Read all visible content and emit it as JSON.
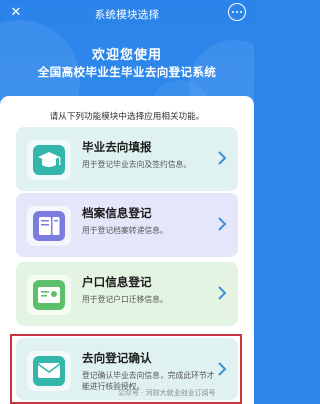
{
  "nav": {
    "title": "系统模块选择",
    "close_icon": "close-icon",
    "more_icon": "more-icon"
  },
  "hero": {
    "line1": "欢迎您使用",
    "line2": "全国高校毕业生毕业去向登记系统"
  },
  "instruction": "请从下列功能模块中选择应用相关功能。",
  "modules": [
    {
      "title": "毕业去向填报",
      "desc": "用于登记毕业去向及签约信息。",
      "icon": "graduation-cap-icon",
      "color": "#dff2f1"
    },
    {
      "title": "档案信息登记",
      "desc": "用于登记档案转递信息。",
      "icon": "archive-icon",
      "color": "#e6e6fb"
    },
    {
      "title": "户口信息登记",
      "desc": "用于登记户口迁移信息。",
      "icon": "id-card-icon",
      "color": "#e3f4e2"
    },
    {
      "title": "去向登记确认",
      "desc": "登记确认毕业去向信息，完成此环节才能进行核验授权。",
      "icon": "confirm-mail-icon",
      "color": "#dff2f1"
    }
  ],
  "watermark": "公众号 · 河财大就业创业订阅号",
  "colors": {
    "brand": "#2a83ea",
    "highlight": "#c8353f",
    "teal": "#2fb7a9",
    "purple": "#7b7ce0",
    "green": "#5cc06a"
  }
}
